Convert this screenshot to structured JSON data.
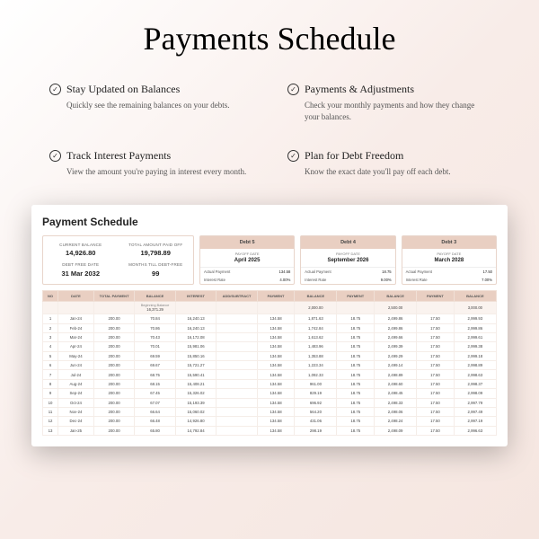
{
  "title": "Payments Schedule",
  "features": [
    {
      "title": "Stay Updated on Balances",
      "desc": "Quickly see the remaining balances on your debts."
    },
    {
      "title": "Payments & Adjustments",
      "desc": "Check your monthly payments and how they change your balances."
    },
    {
      "title": "Track Interest Payments",
      "desc": "View the amount you're paying in interest every month."
    },
    {
      "title": "Plan for Debt Freedom",
      "desc": "Know the exact date you'll pay off each debt."
    }
  ],
  "sheet": {
    "title": "Payment Schedule",
    "summary": {
      "current_balance_lbl": "CURRENT BALANCE",
      "current_balance": "14,926.80",
      "total_paid_lbl": "TOTAL AMOUNT PAID OFF",
      "total_paid": "19,798.89",
      "debt_free_lbl": "DEBT FREE DATE",
      "debt_free": "31 Mar 2032",
      "months_lbl": "MONTHS TILL DEBT-FREE",
      "months": "99"
    },
    "debts": [
      {
        "name": "Debt 5",
        "payoff_lbl": "PAYOFF DATE",
        "payoff": "April 2025",
        "ap_lbl": "Actual Payment",
        "ap": "134.58",
        "ir_lbl": "Interest Rate",
        "ir": "4.00%"
      },
      {
        "name": "Debt 4",
        "payoff_lbl": "PAYOFF DATE",
        "payoff": "September 2026",
        "ap_lbl": "Actual Payment",
        "ap": "18.75",
        "ir_lbl": "Interest Rate",
        "ir": "9.00%"
      },
      {
        "name": "Debt 3",
        "payoff_lbl": "PAYOFF DATE",
        "payoff": "March 2028",
        "ap_lbl": "Actual Payment",
        "ap": "17.50",
        "ir_lbl": "Interest Rate",
        "ir": "7.00%"
      }
    ],
    "columns": [
      "NO",
      "DATE",
      "TOTAL PAYMENT",
      "BALANCE",
      "INTEREST",
      "ADD/SUBTRACT",
      "PAYMENT",
      "BALANCE",
      "PAYMENT",
      "BALANCE",
      "PAYMENT",
      "BALANCE"
    ],
    "beginning_label": "Beginning Balance",
    "beginning": [
      "",
      "",
      "",
      "16,371.29",
      "",
      "",
      "",
      "2,000.00",
      "",
      "2,500.00",
      "",
      "3,000.00"
    ],
    "rows": [
      [
        "1",
        "Jan-24",
        "200.00",
        "70.84",
        "16,240.13",
        "",
        "134.58",
        "1,871.63",
        "18.75",
        "2,499.86",
        "17.50",
        "2,999.93"
      ],
      [
        "2",
        "Feb-24",
        "200.00",
        "70.86",
        "16,240.13",
        "",
        "134.58",
        "1,742.84",
        "18.75",
        "2,499.86",
        "17.50",
        "2,999.86"
      ],
      [
        "3",
        "Mar-24",
        "200.00",
        "70.43",
        "16,172.08",
        "",
        "134.58",
        "1,613.62",
        "18.75",
        "2,499.66",
        "17.50",
        "2,999.61"
      ],
      [
        "4",
        "Apr-24",
        "200.00",
        "70.01",
        "15,981.06",
        "",
        "134.58",
        "1,483.96",
        "18.75",
        "2,499.39",
        "17.50",
        "2,999.38"
      ],
      [
        "5",
        "May-24",
        "200.00",
        "69.59",
        "15,850.16",
        "",
        "134.58",
        "1,353.88",
        "18.75",
        "2,499.29",
        "17.50",
        "2,999.18"
      ],
      [
        "6",
        "Jun-24",
        "200.00",
        "69.67",
        "15,721.27",
        "",
        "134.58",
        "1,223.34",
        "18.75",
        "2,499.14",
        "17.50",
        "2,998.89"
      ],
      [
        "7",
        "Jul-24",
        "200.00",
        "68.75",
        "15,590.41",
        "",
        "134.58",
        "1,092.33",
        "18.75",
        "2,498.89",
        "17.50",
        "2,998.63"
      ],
      [
        "8",
        "Aug-24",
        "200.00",
        "68.15",
        "15,408.21",
        "",
        "134.58",
        "961.00",
        "18.75",
        "2,498.60",
        "17.50",
        "2,998.37"
      ],
      [
        "9",
        "Sep-24",
        "200.00",
        "67.45",
        "15,326.02",
        "",
        "134.58",
        "829.19",
        "18.75",
        "2,498.45",
        "17.50",
        "2,998.09"
      ],
      [
        "10",
        "Oct-24",
        "200.00",
        "67.07",
        "15,193.39",
        "",
        "134.58",
        "696.92",
        "18.75",
        "2,498.33",
        "17.50",
        "2,997.79"
      ],
      [
        "11",
        "Nov-24",
        "200.00",
        "66.64",
        "15,060.02",
        "",
        "134.58",
        "564.20",
        "18.75",
        "2,498.06",
        "17.50",
        "2,997.49"
      ],
      [
        "12",
        "Dec-24",
        "200.00",
        "66.48",
        "14,926.80",
        "",
        "134.58",
        "431.06",
        "18.75",
        "2,498.24",
        "17.50",
        "2,997.19"
      ],
      [
        "13",
        "Jan-25",
        "200.00",
        "65.80",
        "14,792.84",
        "",
        "134.58",
        "298.19",
        "18.75",
        "2,498.09",
        "17.50",
        "2,996.63"
      ]
    ]
  }
}
